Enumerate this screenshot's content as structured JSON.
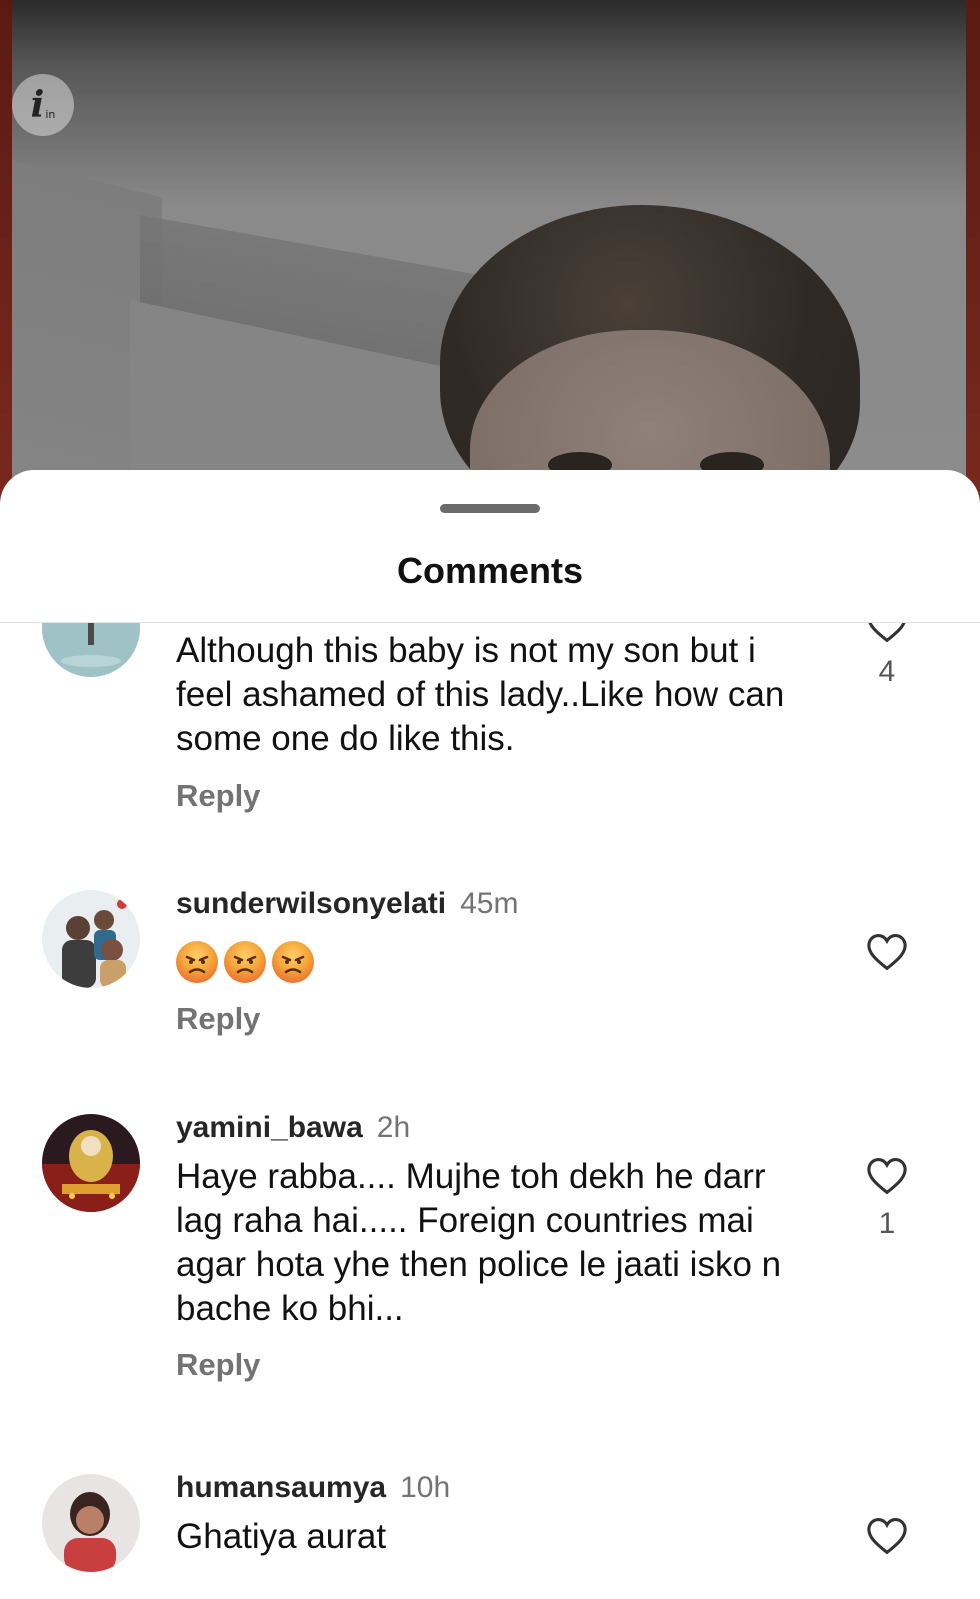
{
  "sheet": {
    "title": "Comments"
  },
  "info_badge": {
    "icon": "info-icon",
    "glyph": "i",
    "suffix": "in"
  },
  "comments": [
    {
      "username": "",
      "time": "",
      "text": "Although this baby is not my son but i feel ashamed of this lady..Like how can some one do like this.",
      "reply_label": "Reply",
      "likes": "4"
    },
    {
      "username": "sunderwilsonyelati",
      "time": "45m",
      "emojis": [
        "angry-face-icon",
        "angry-face-icon",
        "angry-face-icon"
      ],
      "reply_label": "Reply",
      "likes": ""
    },
    {
      "username": "yamini_bawa",
      "time": "2h",
      "text": "Haye rabba.... Mujhe toh dekh he darr lag raha hai..... Foreign countries mai agar hota yhe then police le jaati isko n bache ko bhi...",
      "reply_label": "Reply",
      "likes": "1"
    },
    {
      "username": "humansaumya",
      "time": "10h",
      "text": "Ghatiya aurat",
      "reply_label": "",
      "likes": ""
    }
  ],
  "colors": {
    "sheet_bg": "#ffffff",
    "text": "#111111",
    "muted": "#737373"
  }
}
